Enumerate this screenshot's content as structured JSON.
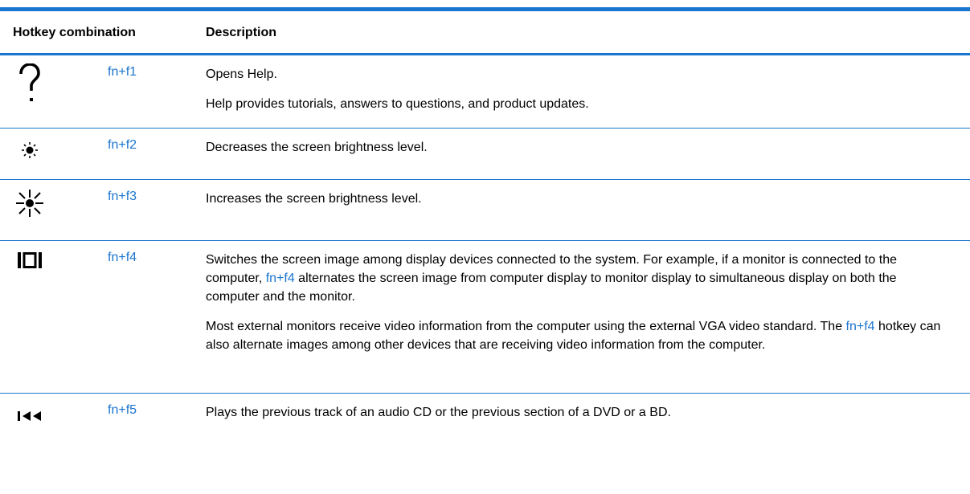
{
  "header": {
    "col1": "Hotkey combination",
    "col2": "Description"
  },
  "rows": [
    {
      "icon": "question-mark-icon",
      "key": "fn+f1",
      "paras": [
        "Opens Help.",
        "Help provides tutorials, answers to questions, and product updates."
      ]
    },
    {
      "icon": "brightness-down-icon",
      "key": "fn+f2",
      "paras": [
        "Decreases the screen brightness level."
      ]
    },
    {
      "icon": "brightness-up-icon",
      "key": "fn+f3",
      "paras": [
        "Increases the screen brightness level."
      ]
    },
    {
      "icon": "display-switch-icon",
      "key": "fn+f4",
      "p1_before": "Switches the screen image among display devices connected to the system. For example, if a monitor is connected to the computer, ",
      "p1_key": "fn+f4",
      "p1_after": " alternates the screen image from computer display to monitor display to simultaneous display on both the computer and the monitor.",
      "p2_before": "Most external monitors receive video information from the computer using the external VGA video standard. The ",
      "p2_key": "fn+f4",
      "p2_after": " hotkey can also alternate images among other devices that are receiving video information from the computer."
    },
    {
      "icon": "previous-track-icon",
      "key": "fn+f5",
      "paras": [
        "Plays the previous track of an audio CD or the previous section of a DVD or a BD."
      ]
    }
  ],
  "colors": {
    "accent": "#1a75ce",
    "text": "#000000"
  }
}
